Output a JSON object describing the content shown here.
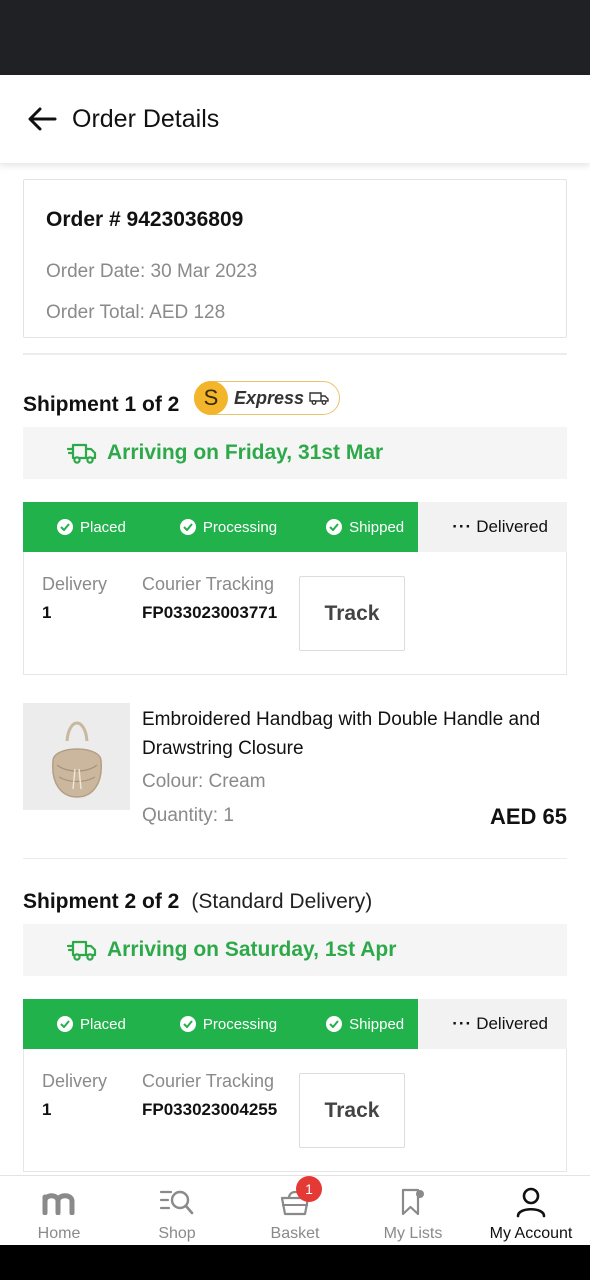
{
  "header": {
    "title": "Order Details"
  },
  "order": {
    "number": "Order # 9423036809",
    "date": "Order Date: 30 Mar 2023",
    "total": "Order Total: AED 128"
  },
  "shipments": [
    {
      "title": "Shipment 1 of 2",
      "express_label": "Express",
      "arriving": "Arriving on Friday, 31st Mar",
      "steps": [
        "Placed",
        "Processing",
        "Shipped"
      ],
      "pending_step": "Delivered",
      "delivery_label": "Delivery",
      "delivery_value": "1",
      "courier_label": "Courier Tracking",
      "courier_value": "FP033023003771",
      "track_label": "Track",
      "product": {
        "name": "Embroidered Handbag with Double Handle and Drawstring Closure",
        "colour": "Colour: Cream",
        "quantity": "Quantity: 1",
        "price": "AED 65"
      }
    },
    {
      "title": "Shipment 2 of 2",
      "type": "(Standard Delivery)",
      "arriving": "Arriving on Saturday, 1st Apr",
      "steps": [
        "Placed",
        "Processing",
        "Shipped"
      ],
      "pending_step": "Delivered",
      "delivery_label": "Delivery",
      "delivery_value": "1",
      "courier_label": "Courier Tracking",
      "courier_value": "FP033023004255",
      "track_label": "Track"
    }
  ],
  "nav": {
    "items": [
      {
        "label": "Home",
        "icon": "m-logo-icon"
      },
      {
        "label": "Shop",
        "icon": "shop-search-icon"
      },
      {
        "label": "Basket",
        "icon": "basket-icon",
        "badge": "1"
      },
      {
        "label": "My Lists",
        "icon": "bookmark-icon"
      },
      {
        "label": "My Account",
        "icon": "user-icon",
        "active": true
      }
    ]
  },
  "colors": {
    "accent_green": "#22b24c",
    "arriving_green": "#2ea94a",
    "badge_red": "#e53935",
    "express_gold": "#f3b52b"
  }
}
